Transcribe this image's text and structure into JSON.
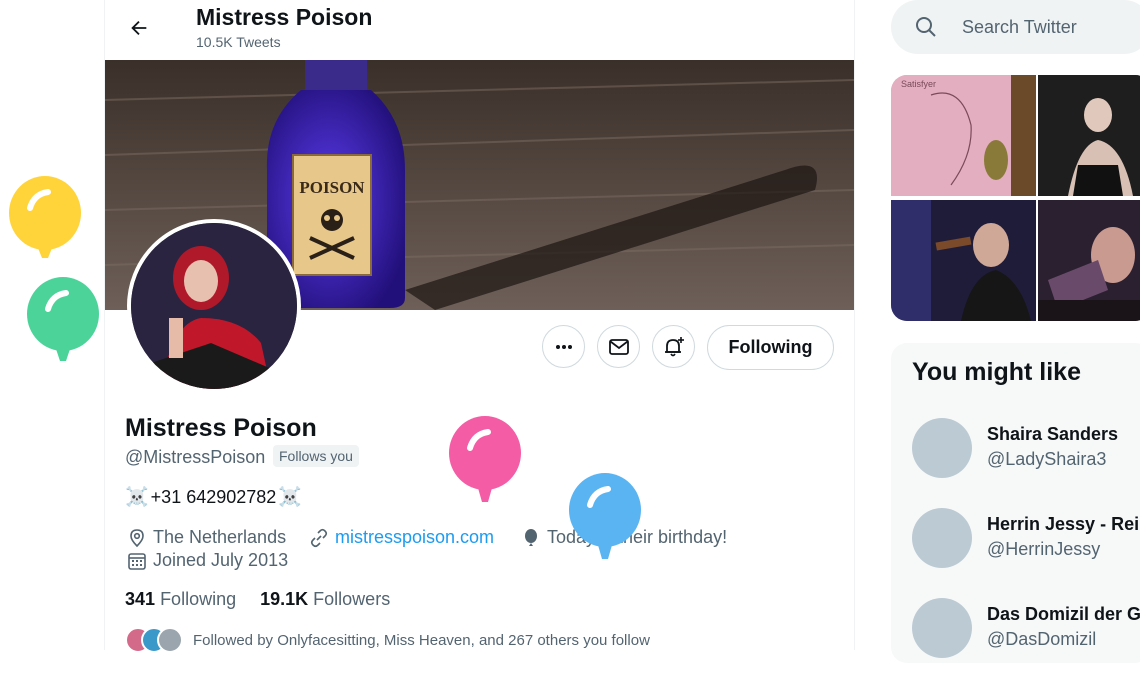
{
  "header": {
    "name": "Mistress Poison",
    "tweet_count": "10.5K Tweets"
  },
  "banner": {
    "label_text": "POISON"
  },
  "actions": {
    "more_icon": "more-dots-icon",
    "message_icon": "mail-icon",
    "notify_icon": "bell-plus-icon",
    "following_label": "Following"
  },
  "profile": {
    "name": "Mistress Poison",
    "handle": "@MistressPoison",
    "follows_you": "Follows you",
    "bio_skull_left": "☠️",
    "bio_text": "+31 642902782",
    "bio_skull_right": "☠️",
    "location": "The Netherlands",
    "website": "mistresspoison.com",
    "birthday": "Today is their birthday!",
    "joined": "Joined July 2013",
    "following_count": "341",
    "following_label": "Following",
    "followers_count": "19.1K",
    "followers_label": "Followers",
    "followed_by": "Followed by Onlyfacesitting, Miss Heaven, and 267 others you follow"
  },
  "search": {
    "placeholder": "Search Twitter"
  },
  "media": {
    "tile1_text": "Satisfyer"
  },
  "who_to_follow": {
    "title": "You might like",
    "items": [
      {
        "name": "Shaira Sanders",
        "handle": "@LadyShaira3"
      },
      {
        "name": "Herrin Jessy - Rei",
        "handle": "@HerrinJessy"
      },
      {
        "name": "Das Domizil der G",
        "handle": "@DasDomizil"
      }
    ]
  },
  "colors": {
    "accent": "#1d9bf0",
    "balloon_yellow": "#ffd43b",
    "balloon_green": "#4cd39a",
    "balloon_pink": "#f45ca5",
    "balloon_blue": "#5ab4f2"
  }
}
